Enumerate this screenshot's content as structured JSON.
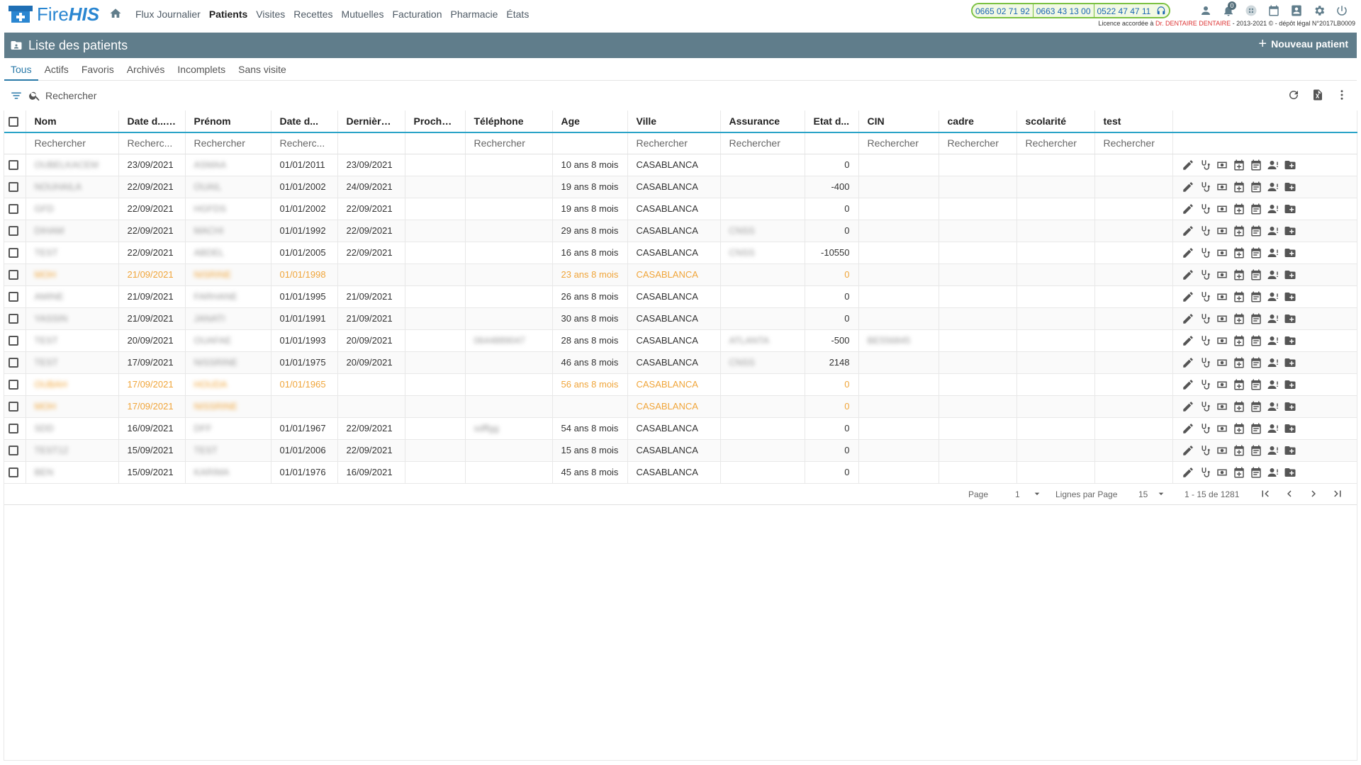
{
  "logo": {
    "fire": "Fire",
    "his": "HIS"
  },
  "nav": [
    "Flux Journalier",
    "Patients",
    "Visites",
    "Recettes",
    "Mutuelles",
    "Facturation",
    "Pharmacie",
    "États"
  ],
  "nav_active_index": 1,
  "phones": [
    "0665 02 71 92",
    "0663 43 13 00",
    "0522 47 47 11"
  ],
  "license": {
    "prefix": "Licence accordée à ",
    "doctor": "Dr. DENTAIRE DENTAIRE",
    "suffix": " - 2013-2021 © - dépôt légal N°2017LB0009"
  },
  "notifications_count": "0",
  "panel": {
    "title": "Liste des patients",
    "new_button": "Nouveau patient"
  },
  "tabs": [
    "Tous",
    "Actifs",
    "Favoris",
    "Archivés",
    "Incomplets",
    "Sans visite"
  ],
  "search": {
    "placeholder": "Rechercher"
  },
  "columns": [
    "Nom",
    "Date d...",
    "Prénom",
    "Date d...",
    "Dernière ...",
    "Prochai...",
    "Téléphone",
    "Age",
    "Ville",
    "Assurance",
    "Etat d...",
    "CIN",
    "cadre",
    "scolarité",
    "test"
  ],
  "filters": [
    "Rechercher",
    "Recherc...",
    "Rechercher",
    "Recherc...",
    "",
    "",
    "Rechercher",
    "",
    "Rechercher",
    "Rechercher",
    "",
    "Rechercher",
    "Rechercher",
    "Rechercher",
    "Rechercher"
  ],
  "rows": [
    {
      "nom": "OUBELKACEM",
      "date_creation": "23/09/2021",
      "prenom": "ASMAA",
      "date_naissance": "01/01/2011",
      "derniere": "23/09/2021",
      "prochaine": "",
      "telephone": "",
      "age": "10 ans 8 mois",
      "ville": "CASABLANCA",
      "assurance": "",
      "etat": "0",
      "cin": "",
      "incomplete": false
    },
    {
      "nom": "NOUHAILA",
      "date_creation": "22/09/2021",
      "prenom": "OUAIL",
      "date_naissance": "01/01/2002",
      "derniere": "24/09/2021",
      "prochaine": "",
      "telephone": "",
      "age": "19 ans 8 mois",
      "ville": "CASABLANCA",
      "assurance": "",
      "etat": "-400",
      "cin": "",
      "incomplete": false
    },
    {
      "nom": "GFD",
      "date_creation": "22/09/2021",
      "prenom": "HGFDS",
      "date_naissance": "01/01/2002",
      "derniere": "22/09/2021",
      "prochaine": "",
      "telephone": "",
      "age": "19 ans 8 mois",
      "ville": "CASABLANCA",
      "assurance": "",
      "etat": "0",
      "cin": "",
      "incomplete": false
    },
    {
      "nom": "DIHAM",
      "date_creation": "22/09/2021",
      "prenom": "MACHI",
      "date_naissance": "01/01/1992",
      "derniere": "22/09/2021",
      "prochaine": "",
      "telephone": "",
      "age": "29 ans 8 mois",
      "ville": "CASABLANCA",
      "assurance": "CNSS",
      "etat": "0",
      "cin": "",
      "incomplete": false
    },
    {
      "nom": "TEST",
      "date_creation": "22/09/2021",
      "prenom": "ABDEL",
      "date_naissance": "01/01/2005",
      "derniere": "22/09/2021",
      "prochaine": "",
      "telephone": "",
      "age": "16 ans 8 mois",
      "ville": "CASABLANCA",
      "assurance": "CNSS",
      "etat": "-10550",
      "cin": "",
      "incomplete": false
    },
    {
      "nom": "MOH",
      "date_creation": "21/09/2021",
      "prenom": "NISRINE",
      "date_naissance": "01/01/1998",
      "derniere": "",
      "prochaine": "",
      "telephone": "",
      "age": "23 ans 8 mois",
      "ville": "CASABLANCA",
      "assurance": "",
      "etat": "0",
      "cin": "",
      "incomplete": true
    },
    {
      "nom": "AMINE",
      "date_creation": "21/09/2021",
      "prenom": "FARHANE",
      "date_naissance": "01/01/1995",
      "derniere": "21/09/2021",
      "prochaine": "",
      "telephone": "",
      "age": "26 ans 8 mois",
      "ville": "CASABLANCA",
      "assurance": "",
      "etat": "0",
      "cin": "",
      "incomplete": false
    },
    {
      "nom": "YASSIN",
      "date_creation": "21/09/2021",
      "prenom": "JANATI",
      "date_naissance": "01/01/1991",
      "derniere": "21/09/2021",
      "prochaine": "",
      "telephone": "",
      "age": "30 ans 8 mois",
      "ville": "CASABLANCA",
      "assurance": "",
      "etat": "0",
      "cin": "",
      "incomplete": false
    },
    {
      "nom": "TEST",
      "date_creation": "20/09/2021",
      "prenom": "OUAFAE",
      "date_naissance": "01/01/1993",
      "derniere": "20/09/2021",
      "prochaine": "",
      "telephone": "0644889047",
      "age": "28 ans 8 mois",
      "ville": "CASABLANCA",
      "assurance": "ATLANTA",
      "etat": "-500",
      "cin": "BE556845",
      "incomplete": false
    },
    {
      "nom": "TEST",
      "date_creation": "17/09/2021",
      "prenom": "NISSRINE",
      "date_naissance": "01/01/1975",
      "derniere": "20/09/2021",
      "prochaine": "",
      "telephone": "",
      "age": "46 ans 8 mois",
      "ville": "CASABLANCA",
      "assurance": "CNSS",
      "etat": "2148",
      "cin": "",
      "incomplete": false
    },
    {
      "nom": "OUBAH",
      "date_creation": "17/09/2021",
      "prenom": "HOUDA",
      "date_naissance": "01/01/1965",
      "derniere": "",
      "prochaine": "",
      "telephone": "",
      "age": "56 ans 8 mois",
      "ville": "CASABLANCA",
      "assurance": "",
      "etat": "0",
      "cin": "",
      "incomplete": true
    },
    {
      "nom": "MOH",
      "date_creation": "17/09/2021",
      "prenom": "NISSRINE",
      "date_naissance": "",
      "derniere": "",
      "prochaine": "",
      "telephone": "",
      "age": "",
      "ville": "CASABLANCA",
      "assurance": "",
      "etat": "0",
      "cin": "",
      "incomplete": true
    },
    {
      "nom": "SDD",
      "date_creation": "16/09/2021",
      "prenom": "DFF",
      "date_naissance": "01/01/1967",
      "derniere": "22/09/2021",
      "prochaine": "",
      "telephone": "sdffgg",
      "age": "54 ans 8 mois",
      "ville": "CASABLANCA",
      "assurance": "",
      "etat": "0",
      "cin": "",
      "incomplete": false
    },
    {
      "nom": "TEST12",
      "date_creation": "15/09/2021",
      "prenom": "TEST",
      "date_naissance": "01/01/2006",
      "derniere": "22/09/2021",
      "prochaine": "",
      "telephone": "",
      "age": "15 ans 8 mois",
      "ville": "CASABLANCA",
      "assurance": "",
      "etat": "0",
      "cin": "",
      "incomplete": false
    },
    {
      "nom": "BEN",
      "date_creation": "15/09/2021",
      "prenom": "KARIMA",
      "date_naissance": "01/01/1976",
      "derniere": "16/09/2021",
      "prochaine": "",
      "telephone": "",
      "age": "45 ans 8 mois",
      "ville": "CASABLANCA",
      "assurance": "",
      "etat": "0",
      "cin": "",
      "incomplete": false
    }
  ],
  "row_actions": [
    "edit-icon",
    "stethoscope-icon",
    "payment-icon",
    "calendar-add-icon",
    "calendar-icon",
    "user-icon",
    "folder-add-icon"
  ],
  "pager": {
    "page_label": "Page",
    "page": "1",
    "rows_label": "Lignes par Page",
    "rows_per_page": "15",
    "range": "1 - 15 de 1281"
  },
  "colors": {
    "header": "#607d8b",
    "accent": "#2979a8",
    "incomplete": "#f0a53a",
    "phone_border": "#7bc142"
  }
}
